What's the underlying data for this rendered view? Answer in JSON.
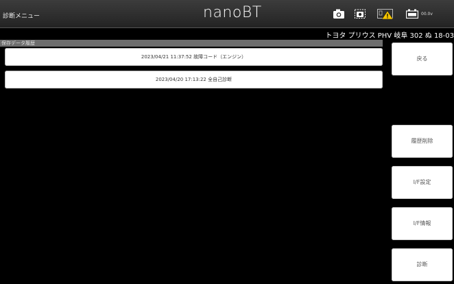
{
  "header": {
    "menu_title": "診断メニュー",
    "app_title": "nanoBT",
    "voltage": "00.0v",
    "icons": [
      "camera-icon",
      "screenshot-icon",
      "adapter-warning-icon",
      "battery-icon"
    ]
  },
  "vehicle": {
    "info": "トヨタ プリウス PHV 岐阜 302 ぬ 18-03"
  },
  "history": {
    "section_label": "保存データ履歴",
    "items": [
      "2023/04/21 11:37:52 故障コード（エンジン）",
      "2023/04/20 17:13:22 全自己診断"
    ]
  },
  "sidebar": {
    "back": "戻る",
    "delete_history": "履歴削除",
    "if_settings": "I/F設定",
    "if_info": "I/F情報",
    "diagnosis": "診断"
  },
  "colors": {
    "background": "#000000",
    "header": "#2e2e2e",
    "button": "#ffffff",
    "warning": "#f5c400"
  }
}
